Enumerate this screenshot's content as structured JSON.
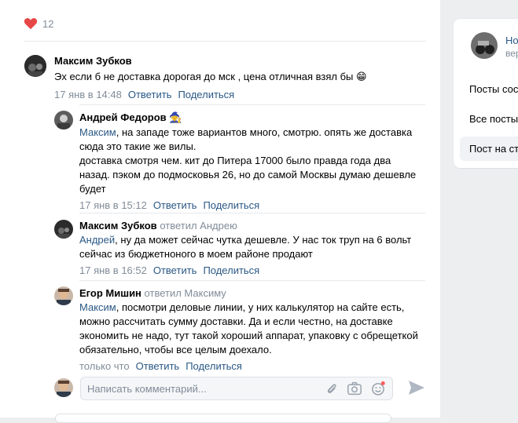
{
  "likes": {
    "count": "12"
  },
  "comments": [
    {
      "author": "Максим Зубков",
      "replied_to": "",
      "mention": "",
      "text": "Эх если б не доставка дорогая до мск , цена отличная взял бы",
      "emoji": "😁",
      "time": "17 янв в 14:48",
      "reply_label": "Ответить",
      "share_label": "Поделиться"
    },
    {
      "author": "Андрей Федоров",
      "badge": "🧙",
      "mention": "Максим",
      "text_lines": [
        ", на западе тоже вариантов много, смотрю. опять же доставка",
        "сюда это такие же вилы.",
        "доставка смотря чем. кит до Питера 17000 было правда года два",
        "назад. пэком до подмосковья 26, но до самой Москвы думаю дешевле",
        "будет"
      ],
      "time": "17 янв в 15:12",
      "reply_label": "Ответить",
      "share_label": "Поделиться"
    },
    {
      "author": "Максим Зубков",
      "replied_to": "ответил Андрею",
      "mention": "Андрей",
      "text_lines": [
        ", ну да может сейчас чутка дешевле. У нас ток труп на 6 вольт",
        "сейчас из бюджетноного в моем районе продают"
      ],
      "time": "17 янв в 16:52",
      "reply_label": "Ответить",
      "share_label": "Поделиться"
    },
    {
      "author": "Егор Мишин",
      "replied_to": "ответил Максиму",
      "mention": "Максим",
      "text_lines": [
        ", посмотри деловые линии, у них калькулятор на сайте есть,",
        "можно рассчитать сумму доставки. Да и если честно, на доставке",
        "экономить не надо, тут такой хороший аппарат, упаковку с обрещеткой",
        "обязательно, чтобы все целым доехало."
      ],
      "time": "только что",
      "reply_label": "Ответить",
      "share_label": "Поделиться"
    }
  ],
  "comment_input": {
    "placeholder": "Написать комментарий..."
  },
  "sidebar": {
    "profile_line1": "Но",
    "profile_line2": "вер",
    "items": [
      "Посты сос",
      "Все посты",
      "Пост на ст"
    ]
  },
  "colors": {
    "link": "#2a5885",
    "muted": "#818c99",
    "heart": "#e64646",
    "send": "#aeb7c2"
  }
}
